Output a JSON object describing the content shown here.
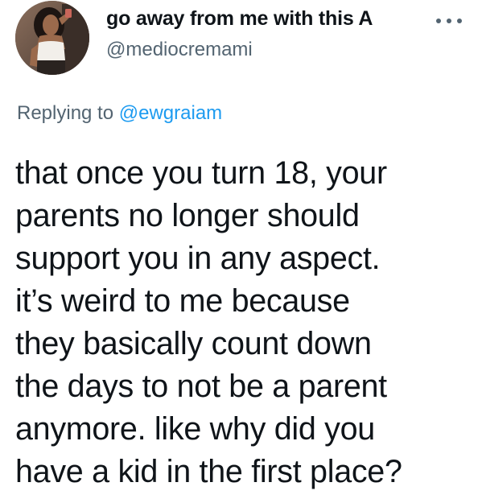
{
  "author": {
    "display_name": "go away from me with this A",
    "handle": "@mediocremami",
    "avatar_icon": "profile-photo"
  },
  "more_icon": "more-horizontal-icon",
  "reply": {
    "prefix": "Replying to",
    "mention": "@ewgraiam"
  },
  "tweet": {
    "lines": [
      "that once you turn 18, your",
      "parents no longer should",
      "support you in any aspect.",
      "it’s weird to me because",
      "they basically count down",
      "the days to not be a parent",
      "anymore. like why did you",
      "have a kid in the first place?"
    ]
  },
  "colors": {
    "text_primary": "#0f1419",
    "text_secondary": "#536471",
    "accent": "#1d9bf0",
    "background": "#ffffff"
  }
}
